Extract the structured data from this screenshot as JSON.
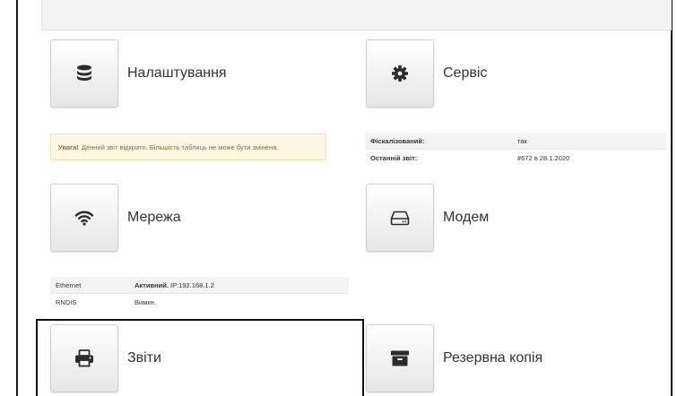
{
  "tiles": {
    "settings": {
      "label": "Налаштування",
      "icon": "database-icon"
    },
    "service": {
      "label": "Сервіс",
      "icon": "gear-icon"
    },
    "network": {
      "label": "Мережа",
      "icon": "wifi-icon"
    },
    "modem": {
      "label": "Модем",
      "icon": "hard-drive-icon"
    },
    "reports": {
      "label": "Звіти",
      "icon": "printer-icon"
    },
    "backup": {
      "label": "Резервна копія",
      "icon": "archive-box-icon"
    }
  },
  "alert": {
    "strong": "Увага!",
    "text": "Денний звіт відкрито. Більшість таблиць не може бути змінена."
  },
  "fiscal_info": [
    {
      "key": "Фіскалізований:",
      "value": "так"
    },
    {
      "key": "Останній звіт:",
      "value": "#672 в 28.1.2020"
    }
  ],
  "network_status": [
    {
      "key": "Ethernet",
      "value_strong": "Активний.",
      "value": "IP:192.168.1.2"
    },
    {
      "key": "RNDIS",
      "value_strong": "",
      "value": "Вимкн."
    }
  ],
  "colors": {
    "alert_bg": "#fcf8e3",
    "alert_text": "#8a6d3b",
    "icon": "#2b2b2b"
  }
}
